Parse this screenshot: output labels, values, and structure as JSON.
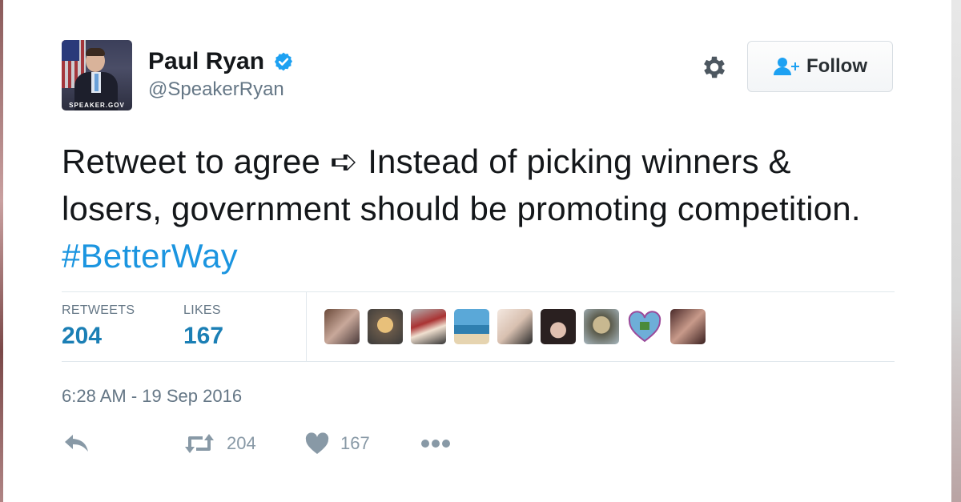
{
  "user": {
    "name": "Paul Ryan",
    "handle": "@SpeakerRyan",
    "avatar_label": "SPEAKER.GOV",
    "verified": true
  },
  "follow_button": {
    "label": "Follow"
  },
  "tweet": {
    "text_before": "Retweet to agree ➪ Instead of picking winners & losers, government should be promoting competition.",
    "hashtag": "#BetterWay"
  },
  "stats": {
    "retweets_label": "RETWEETS",
    "retweets_value": "204",
    "likes_label": "LIKES",
    "likes_value": "167"
  },
  "timestamp": "6:28 AM - 19 Sep 2016",
  "actions": {
    "retweet_count": "204",
    "like_count": "167"
  },
  "colors": {
    "link": "#1b95e0",
    "stat_value": "#1b7fb5",
    "muted": "#657786",
    "icon_gray": "#8899a6"
  }
}
